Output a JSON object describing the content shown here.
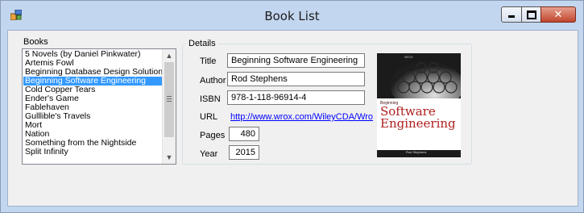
{
  "window": {
    "title": "Book List"
  },
  "books": {
    "label": "Books",
    "items": [
      "5 Novels (by Daniel Pinkwater)",
      "Artemis Fowl",
      "Beginning Database Design Solutions",
      "Beginning Software Engineering",
      "Cold Copper Tears",
      "Ender's Game",
      "Fablehaven",
      "Gulllible's Travels",
      "Mort",
      "Nation",
      "Something from the Nightside",
      "Split Infinity"
    ],
    "selected_index": 3
  },
  "details": {
    "label": "Details",
    "title_label": "Title",
    "title_value": "Beginning Software Engineering",
    "author_label": "Author",
    "author_value": "Rod Stephens",
    "isbn_label": "ISBN",
    "isbn_value": "978-1-118-96914-4",
    "url_label": "URL",
    "url_value": "http://www.wrox.com/WileyCDA/Wro",
    "pages_label": "Pages",
    "pages_value": "480",
    "year_label": "Year",
    "year_value": "2015"
  },
  "cover": {
    "small_line": "Beginning",
    "word1": "Software",
    "word2": "Engineering",
    "author": "Rod Stephens"
  },
  "colors": {
    "title_bar": "#c3d6ef",
    "selection": "#3399ff",
    "link": "#0000ff",
    "close_button": "#c0452d"
  },
  "icons": [
    "app-icon",
    "minimize-icon",
    "maximize-icon",
    "close-icon",
    "scroll-up-arrow-icon",
    "scroll-down-arrow-icon",
    "scroll-grip-icon"
  ]
}
